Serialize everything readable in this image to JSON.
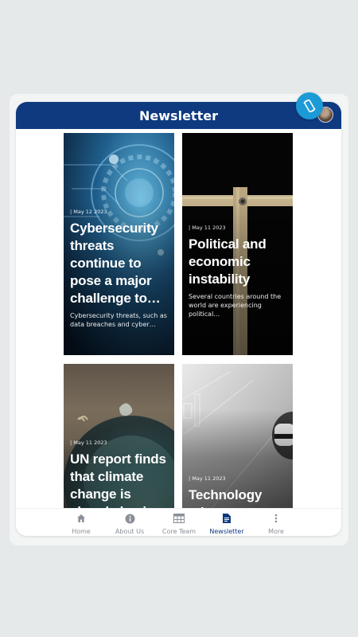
{
  "header": {
    "title": "Newsletter"
  },
  "articles": [
    {
      "date": "| May 12 2023",
      "title": "Cybersecurity threats continue to pose a major challenge to…",
      "excerpt": "Cybersecurity threats, such as data breaches and cyber…"
    },
    {
      "date": "| May 11 2023",
      "title": "Political and economic instability",
      "excerpt": "Several countries around the world are experiencing political…"
    },
    {
      "date": "| May 11 2023",
      "title": "UN report finds that climate change is already havin",
      "excerpt": ""
    },
    {
      "date": "| May 11 2023",
      "title": "Technology advancements",
      "excerpt": ""
    }
  ],
  "tabs": [
    {
      "label": "Home",
      "icon": "home-icon"
    },
    {
      "label": "About Us",
      "icon": "info-icon"
    },
    {
      "label": "Core Team",
      "icon": "team-grid-icon"
    },
    {
      "label": "Newsletter",
      "icon": "document-icon"
    },
    {
      "label": "More",
      "icon": "more-vertical-icon"
    }
  ],
  "colors": {
    "header": "#0f3a80",
    "accent": "#1c9ad6",
    "active_tab": "#0f3a80",
    "inactive_tab": "#8a8f98"
  }
}
